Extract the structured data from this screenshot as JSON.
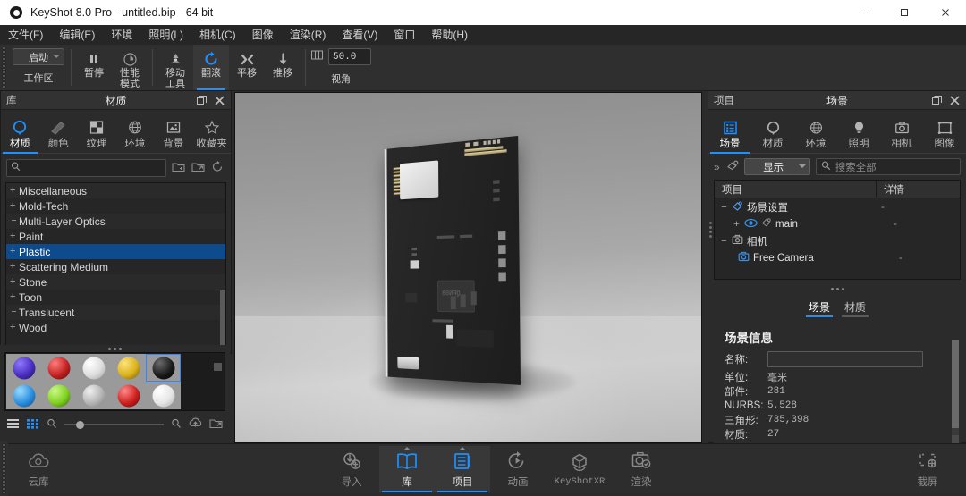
{
  "window": {
    "title": "KeyShot 8.0 Pro  - untitled.bip  - 64 bit",
    "app_icon": "keyshot-logo-icon",
    "minimize": "minimize-icon",
    "maximize": "maximize-icon",
    "close": "close-icon"
  },
  "menubar": {
    "items": [
      {
        "label": "文件(F)"
      },
      {
        "label": "编辑(E)"
      },
      {
        "label": "环境"
      },
      {
        "label": "照明(L)"
      },
      {
        "label": "相机(C)"
      },
      {
        "label": "图像"
      },
      {
        "label": "渲染(R)"
      },
      {
        "label": "查看(V)"
      },
      {
        "label": "窗口"
      },
      {
        "label": "帮助(H)"
      }
    ]
  },
  "toolbar": {
    "workspace": {
      "value": "启动",
      "label": "工作区"
    },
    "buttons": [
      {
        "label": "暂停",
        "icon": "pause-icon",
        "active": false
      },
      {
        "label": "性能\n模式",
        "icon": "performance-icon",
        "active": false
      },
      {
        "label": "移动\n工具",
        "icon": "move-tool-icon",
        "active": false
      },
      {
        "label": "翻滚",
        "icon": "tumble-icon",
        "active": true
      },
      {
        "label": "平移",
        "icon": "pan-icon",
        "active": false
      },
      {
        "label": "推移",
        "icon": "dolly-icon",
        "active": false
      }
    ],
    "view_angle": {
      "icon": "grid-icon",
      "value": "50.0",
      "label": "视角"
    }
  },
  "library": {
    "header_left": "库",
    "header_title": "材质",
    "restore_icon": "restore-icon",
    "close_icon": "close-icon",
    "tabs": [
      {
        "label": "材质",
        "icon": "material-ball-icon",
        "active": true
      },
      {
        "label": "颜色",
        "icon": "color-swatch-icon",
        "active": false
      },
      {
        "label": "纹理",
        "icon": "texture-checker-icon",
        "active": false
      },
      {
        "label": "环境",
        "icon": "globe-icon",
        "active": false
      },
      {
        "label": "背景",
        "icon": "picture-icon",
        "active": false
      },
      {
        "label": "收藏夹",
        "icon": "star-icon",
        "active": false
      }
    ],
    "search": {
      "value": "",
      "placeholder": "",
      "icon": "search-icon"
    },
    "search_actions": [
      "folder-add-icon",
      "folder-link-icon",
      "refresh-icon"
    ],
    "tree": [
      {
        "label": "Miscellaneous",
        "expandable": true,
        "selected": false
      },
      {
        "label": "Mold-Tech",
        "expandable": true,
        "selected": false
      },
      {
        "label": "Multi-Layer Optics",
        "expandable": false,
        "selected": false
      },
      {
        "label": "Paint",
        "expandable": true,
        "selected": false
      },
      {
        "label": "Plastic",
        "expandable": true,
        "selected": true
      },
      {
        "label": "Scattering Medium",
        "expandable": true,
        "selected": false
      },
      {
        "label": "Stone",
        "expandable": true,
        "selected": false
      },
      {
        "label": "Toon",
        "expandable": true,
        "selected": false
      },
      {
        "label": "Translucent",
        "expandable": false,
        "selected": false
      },
      {
        "label": "Wood",
        "expandable": true,
        "selected": false
      }
    ]
  },
  "material_swatches": {
    "items": [
      {
        "name": "purple-material-swatch",
        "color": "#4b2fc0",
        "selected": false
      },
      {
        "name": "red-material-swatch",
        "color": "#c32222",
        "selected": false
      },
      {
        "name": "white-material-swatch",
        "color": "#dedede",
        "selected": false
      },
      {
        "name": "yellow-material-swatch",
        "color": "#d9b21c",
        "selected": false
      },
      {
        "name": "black-material-swatch",
        "color": "#191919",
        "selected": true
      },
      {
        "name": "blue-material-swatch",
        "color": "#2b8fe0",
        "selected": false
      },
      {
        "name": "green-material-swatch",
        "color": "#7fd11f",
        "selected": false
      },
      {
        "name": "gray-material-swatch",
        "color": "#b5b5b5",
        "selected": false
      },
      {
        "name": "red2-material-swatch",
        "color": "#cf1f1f",
        "selected": false
      },
      {
        "name": "offwhite-material-swatch",
        "color": "#e6e6e6",
        "selected": false
      }
    ],
    "footer_icons": [
      "list-view-icon",
      "grid-view-icon",
      "zoom-out-icon",
      "zoom-in-icon",
      "upload-icon",
      "folder-icon"
    ]
  },
  "viewport": {
    "model_name": "pcb-board-model",
    "chip_label": "QFN08"
  },
  "project": {
    "header_left": "项目",
    "header_title": "场景",
    "restore_icon": "restore-icon",
    "close_icon": "close-icon",
    "tabs": [
      {
        "label": "场景",
        "icon": "scene-list-icon",
        "active": true
      },
      {
        "label": "材质",
        "icon": "material-ball-icon",
        "active": false
      },
      {
        "label": "环境",
        "icon": "globe-icon",
        "active": false
      },
      {
        "label": "照明",
        "icon": "lightbulb-icon",
        "active": false
      },
      {
        "label": "相机",
        "icon": "camera-icon",
        "active": false
      },
      {
        "label": "图像",
        "icon": "image-frame-icon",
        "active": false
      }
    ],
    "filter": {
      "chevron": "chevron-right-icon",
      "link_icon": "link-scene-icon",
      "show_label": "显示",
      "search_placeholder": "搜索全部",
      "search_icon": "search-icon"
    },
    "tree_headers": {
      "col1": "项目",
      "col2": "详情"
    },
    "tree_rows": [
      {
        "label": "场景设置",
        "detail": "-",
        "indent": 0,
        "toggle": "minus",
        "icon": "scene-settings-icon"
      },
      {
        "label": "main",
        "detail": "-",
        "indent": 1,
        "toggle": "plus",
        "icon": "eye-icon"
      },
      {
        "label": "相机",
        "detail": "",
        "indent": 0,
        "toggle": "minus",
        "icon": "camera-icon"
      },
      {
        "label": "Free Camera",
        "detail": "-",
        "indent": 1,
        "toggle": "none",
        "icon": "camera-icon"
      }
    ],
    "subtabs": [
      {
        "label": "场景",
        "active": true
      },
      {
        "label": "材质",
        "active": false
      }
    ],
    "scene_info": {
      "title": "场景信息",
      "name_label": "名称:",
      "name_value": "",
      "rows": [
        {
          "key": "单位:",
          "value": "毫米"
        },
        {
          "key": "部件:",
          "value": "281"
        },
        {
          "key": "NURBS:",
          "value": "5,528"
        },
        {
          "key": "三角形:",
          "value": "735,398"
        },
        {
          "key": "材质:",
          "value": "27"
        }
      ]
    }
  },
  "bottombar": {
    "left": {
      "label": "云库",
      "icon": "cloud-icon"
    },
    "items": [
      {
        "label": "导入",
        "icon": "import-icon",
        "active": false
      },
      {
        "label": "库",
        "icon": "book-icon",
        "active": true
      },
      {
        "label": "项目",
        "icon": "project-list-icon",
        "active": true
      },
      {
        "label": "动画",
        "icon": "animation-icon",
        "active": false
      },
      {
        "label": "KeyShotXR",
        "icon": "xr-cube-icon",
        "active": false
      },
      {
        "label": "渲染",
        "icon": "render-camera-icon",
        "active": false
      }
    ],
    "right": {
      "label": "截屏",
      "icon": "screenshot-icon"
    }
  },
  "colors": {
    "accent": "#1e90ff",
    "panel_bg": "#2b2b2b",
    "toolbar_bg": "#2f2f2f",
    "selection_blue": "#0d4b8c",
    "titlebar_bg": "#ffffff"
  }
}
